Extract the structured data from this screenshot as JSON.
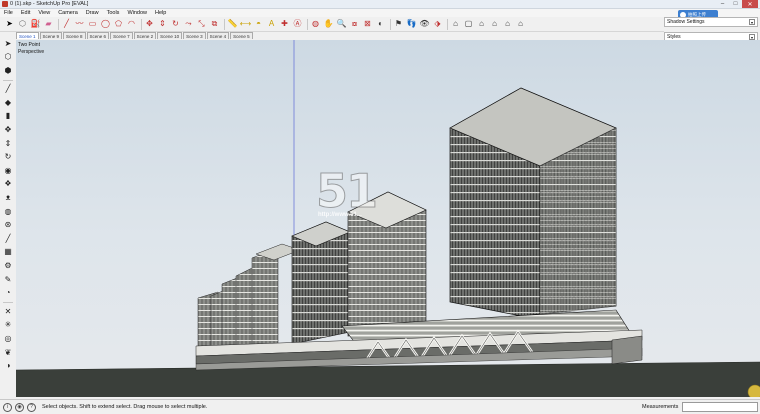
{
  "window": {
    "title": "0 (1).skp - SketchUp Pro [EVAL]"
  },
  "menu": [
    "File",
    "Edit",
    "View",
    "Camera",
    "Draw",
    "Tools",
    "Window",
    "Help"
  ],
  "scenes": [
    {
      "label": "Scene 1",
      "active": true
    },
    {
      "label": "Scene 9"
    },
    {
      "label": "Scene 8"
    },
    {
      "label": "Scene 6"
    },
    {
      "label": "Scene 7"
    },
    {
      "label": "Scene 2"
    },
    {
      "label": "Scene 10"
    },
    {
      "label": "Scene 3"
    },
    {
      "label": "Scene 4"
    },
    {
      "label": "Scene 5"
    }
  ],
  "viewport": {
    "label_line1": "Two Point",
    "label_line2": "Perspective"
  },
  "watermark": {
    "logo_text": "51",
    "url_text": "http://www.51..."
  },
  "trays": {
    "shadow_settings": "Shadow Settings",
    "styles": "Styles"
  },
  "badge": {
    "text": "拍照上传"
  },
  "status": {
    "hint": "Select objects. Shift to extend select. Drag mouse to select multiple.",
    "measurements_label": "Measurements",
    "measurements_value": ""
  },
  "colors": {
    "sky_top": "#cdd9e3",
    "ground": "#3a3f3a",
    "selection_blue": "#3d7fd0"
  }
}
